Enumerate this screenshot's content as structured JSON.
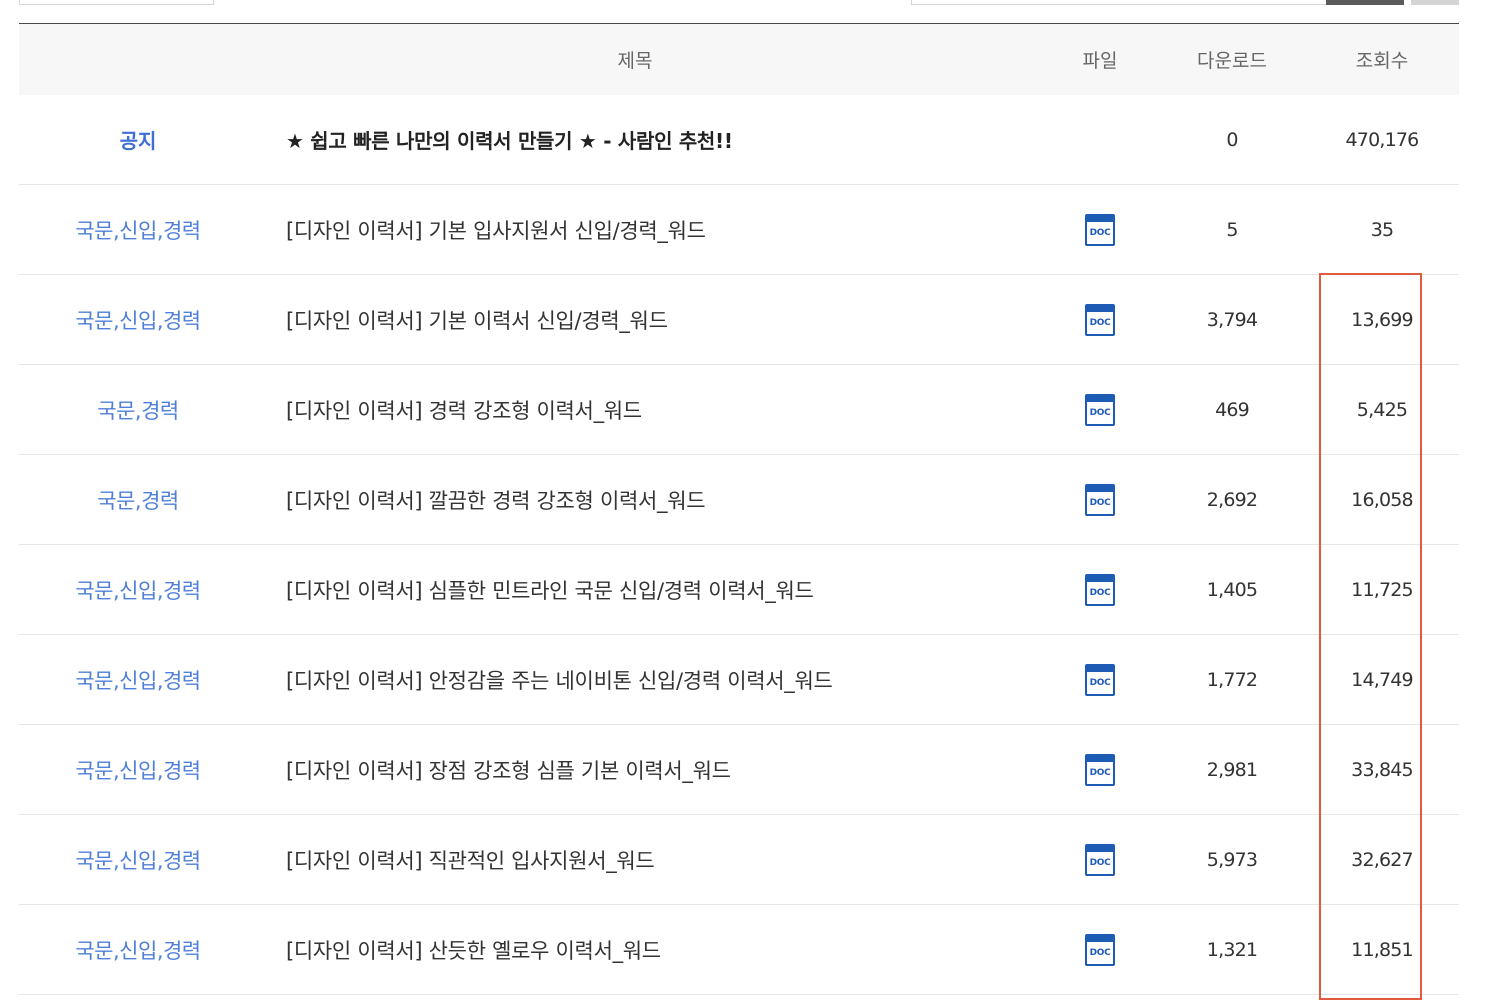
{
  "header": {
    "title": "제목",
    "file": "파일",
    "downloads": "다운로드",
    "views": "조회수"
  },
  "notice": {
    "category": "공지",
    "title": "★ 쉽고 빠른 나만의 이력서 만들기 ★ - 사람인 추천!!",
    "downloads": "0",
    "views": "470,176"
  },
  "file_icon": {
    "name": "doc-file-icon",
    "label": "DOC",
    "color": "#1d5bb5"
  },
  "colors": {
    "category": "#4f7fd8",
    "highlight": "#e05a40"
  },
  "rows": [
    {
      "category": "국문,신입,경력",
      "title": "[디자인 이력서] 기본 입사지원서 신입/경력_워드",
      "downloads": "5",
      "views": "35"
    },
    {
      "category": "국문,신입,경력",
      "title": "[디자인 이력서] 기본 이력서 신입/경력_워드",
      "downloads": "3,794",
      "views": "13,699"
    },
    {
      "category": "국문,경력",
      "title": "[디자인 이력서] 경력 강조형 이력서_워드",
      "downloads": "469",
      "views": "5,425"
    },
    {
      "category": "국문,경력",
      "title": "[디자인 이력서] 깔끔한 경력 강조형 이력서_워드",
      "downloads": "2,692",
      "views": "16,058"
    },
    {
      "category": "국문,신입,경력",
      "title": "[디자인 이력서] 심플한 민트라인 국문 신입/경력 이력서_워드",
      "downloads": "1,405",
      "views": "11,725"
    },
    {
      "category": "국문,신입,경력",
      "title": "[디자인 이력서] 안정감을 주는 네이비톤 신입/경력 이력서_워드",
      "downloads": "1,772",
      "views": "14,749"
    },
    {
      "category": "국문,신입,경력",
      "title": "[디자인 이력서] 장점 강조형 심플 기본 이력서_워드",
      "downloads": "2,981",
      "views": "33,845"
    },
    {
      "category": "국문,신입,경력",
      "title": "[디자인 이력서] 직관적인 입사지원서_워드",
      "downloads": "5,973",
      "views": "32,627"
    },
    {
      "category": "국문,신입,경력",
      "title": "[디자인 이력서] 산듯한 옐로우 이력서_워드",
      "downloads": "1,321",
      "views": "11,851"
    }
  ]
}
